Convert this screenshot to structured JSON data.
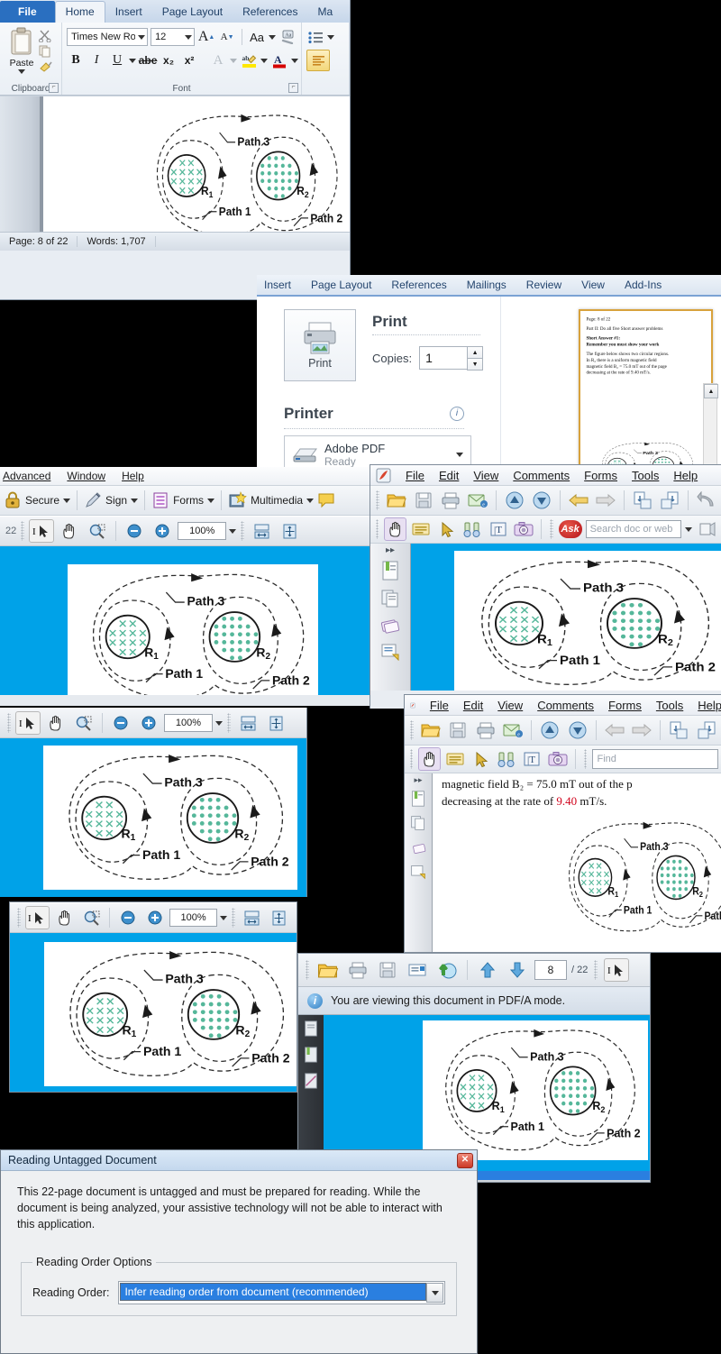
{
  "word": {
    "tabs": [
      {
        "label": "File",
        "kind": "file"
      },
      {
        "label": "Home",
        "kind": "active"
      },
      {
        "label": "Insert",
        "kind": "normal"
      },
      {
        "label": "Page Layout",
        "kind": "normal"
      },
      {
        "label": "References",
        "kind": "normal"
      },
      {
        "label": "Ma",
        "kind": "normal"
      }
    ],
    "clipboard": {
      "paste": "Paste",
      "group": "Clipboard"
    },
    "font": {
      "family": "Times New Rom",
      "size": "12",
      "group": "Font",
      "bold": "B",
      "italic": "I",
      "underline": "U",
      "strike": "abe",
      "subscript": "x₂",
      "superscript": "x²",
      "changecase": "Aa"
    },
    "status": {
      "page": "Page: 8 of 22",
      "words": "Words: 1,707"
    }
  },
  "backstage": {
    "tabs": [
      "Insert",
      "Page Layout",
      "References",
      "Mailings",
      "Review",
      "View",
      "Add-Ins"
    ],
    "print_heading": "Print",
    "print_button": "Print",
    "copies_label": "Copies:",
    "copies_value": "1",
    "printer_heading": "Printer",
    "printer_name": "Adobe PDF",
    "printer_status": "Ready",
    "preview": {
      "line1": "Page: 8 of 22",
      "line2": "Part II:  Do all five Short answer problems",
      "line3": "Short Answer #1:",
      "line4": "Remember you must show your work",
      "line5": "The figure below shows two circular regions.",
      "line6": "In R₂ there is a uniform magnetic field",
      "line7": "magnetic field B₂ = 75.0 mT out of the page",
      "line8": "decreasing at the rate of 9.40 mT/s."
    }
  },
  "acrobat_a": {
    "menu": [
      "Advanced",
      "Window",
      "Help"
    ],
    "toolbar2": [
      "Secure",
      "Sign",
      "Forms",
      "Multimedia"
    ],
    "page_total": "22",
    "zoom": "100%"
  },
  "acrobat_b": {
    "menu": [
      "File",
      "Edit",
      "View",
      "Comments",
      "Forms",
      "Tools",
      "Help"
    ],
    "search_placeholder": "Search doc or web"
  },
  "acrobat_c": {
    "zoom": "100%"
  },
  "acrobat_c2": {
    "zoom": "100%"
  },
  "acrobat_d": {
    "menu": [
      "File",
      "Edit",
      "View",
      "Comments",
      "Forms",
      "Tools",
      "Help"
    ],
    "find_placeholder": "Find",
    "text_line1": "magnetic field B₂ =  75.0  mT out of the p",
    "text_line1_red": "75.0",
    "text_line2_pre": "decreasing at the rate of ",
    "text_line2_red": "9.40",
    "text_line2_post": " mT/s."
  },
  "pdfa": {
    "page_current": "8",
    "page_total": "/ 22",
    "notice": "You are viewing this document in PDF/A mode."
  },
  "dialog": {
    "title": "Reading Untagged Document",
    "body": "This 22-page document is untagged and must be prepared for reading. While the document is being analyzed, your assistive technology will not be able to interact with this application.",
    "group_label": "Reading Order Options",
    "field_label": "Reading Order:",
    "field_value": "Infer reading order from document (recommended)"
  },
  "figure": {
    "path1": "Path 1",
    "path2": "Path 2",
    "path3": "Path 3",
    "r1": "R",
    "r1sub": "1",
    "r2": "R",
    "r2sub": "2",
    "field_into_page_symbol": "×",
    "field_out_of_page_symbol": "•",
    "accent": "#55b79a"
  },
  "colors": {
    "acrobat_page_bg": "#00a2e8",
    "word_accent": "#2a6fc0",
    "highlight_blue": "#2a7fe0",
    "red_value": "#d0021b"
  }
}
